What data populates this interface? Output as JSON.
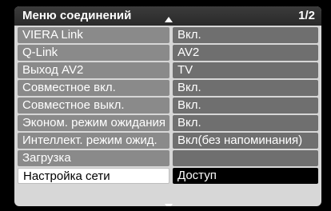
{
  "menu": {
    "title": "Меню соединений",
    "page": "1/2",
    "rows": [
      {
        "label": "VIERA Link",
        "value": "Вкл."
      },
      {
        "label": "Q-Link",
        "value": "AV2"
      },
      {
        "label": "Выход AV2",
        "value": "TV"
      },
      {
        "label": "Совместное вкл.",
        "value": "Вкл."
      },
      {
        "label": "Совместное выкл.",
        "value": "Вкл."
      },
      {
        "label": "Эконом. режим ожидания",
        "value": "Вкл."
      },
      {
        "label": "Интеллект. режим ожид.",
        "value": "Вкл(без напоминания)"
      },
      {
        "label": "Загрузка",
        "value": ""
      },
      {
        "label": "Настройка сети",
        "value": "Доступ"
      }
    ]
  }
}
